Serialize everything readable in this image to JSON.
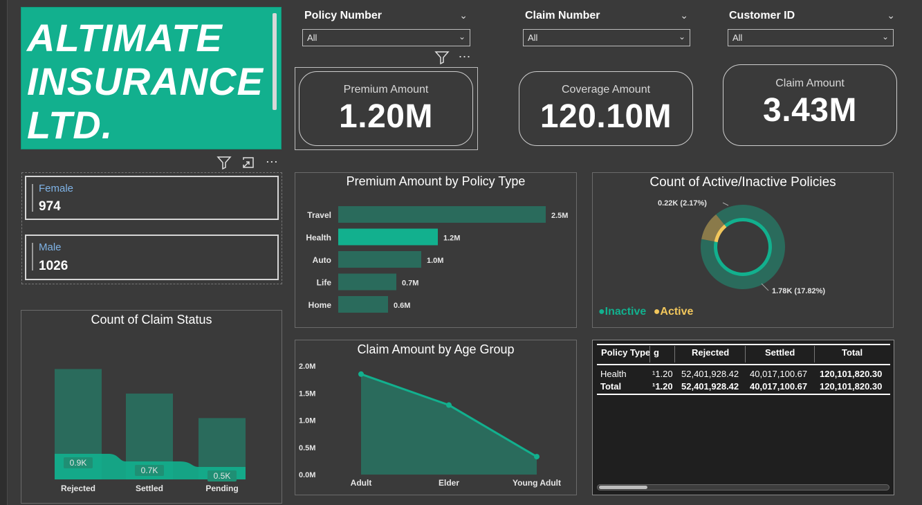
{
  "brand": {
    "lines": [
      "ALTIMATE",
      "INSURANCE",
      "LTD."
    ],
    "color": "#12b08e"
  },
  "slicers": [
    {
      "title": "Policy Number",
      "value": "All"
    },
    {
      "title": "Claim Number",
      "value": "All"
    },
    {
      "title": "Customer ID",
      "value": "All"
    }
  ],
  "kpis": [
    {
      "label": "Premium Amount",
      "value": "1.20M"
    },
    {
      "label": "Coverage Amount",
      "value": "120.10M"
    },
    {
      "label": "Claim Amount",
      "value": "3.43M"
    }
  ],
  "icons": {
    "filter": "filter-icon",
    "more": "more-options-icon",
    "focus": "focus-mode-icon",
    "chevron": "chevron-down-icon"
  },
  "gender_cards": [
    {
      "label": "Female",
      "value": "974"
    },
    {
      "label": "Male",
      "value": "1026"
    }
  ],
  "premium_chart": {
    "title": "Premium Amount by Policy Type",
    "type": "bar",
    "categories": [
      "Travel",
      "Health",
      "Auto",
      "Life",
      "Home"
    ],
    "values": [
      2.5,
      1.2,
      1.0,
      0.7,
      0.6
    ],
    "labels": [
      "2.5M",
      "1.2M",
      "1.0M",
      "0.7M",
      "0.6M"
    ],
    "highlight": "Health",
    "colors": {
      "bar": "#2a6b5c",
      "highlight": "#12b08e"
    }
  },
  "donut_chart": {
    "title": "Count of Active/Inactive Policies",
    "type": "pie",
    "slices": [
      {
        "name": "Inactive",
        "value": 1.78,
        "label": "1.78K (17.82%)",
        "color": "#12b08e"
      },
      {
        "name": "Active",
        "value": 0.22,
        "label": "0.22K (2.17%)",
        "color": "#f2c75c"
      }
    ],
    "legend": [
      "Inactive",
      "Active"
    ]
  },
  "claim_status_chart": {
    "title": "Count of Claim Status",
    "type": "bar",
    "categories": [
      "Rejected",
      "Settled",
      "Pending"
    ],
    "values": [
      0.9,
      0.7,
      0.5
    ],
    "labels": [
      "0.9K",
      "0.7K",
      "0.5K"
    ],
    "ylim": [
      0,
      1.1
    ]
  },
  "age_chart": {
    "title": "Claim Amount by Age Group",
    "type": "area",
    "categories": [
      "Adult",
      "Elder",
      "Young Adult"
    ],
    "values": [
      1.85,
      1.28,
      0.33
    ],
    "yticks": [
      "0.0M",
      "0.5M",
      "1.0M",
      "1.5M",
      "2.0M"
    ],
    "ylim": [
      0,
      2.0
    ]
  },
  "table": {
    "headers": [
      "Policy Type",
      "g",
      "Rejected",
      "Settled",
      "Total"
    ],
    "rows": [
      [
        "Health",
        "¹1.20",
        "52,401,928.42",
        "40,017,100.67",
        "120,101,820.30"
      ],
      [
        "Total",
        "¹1.20",
        "52,401,928.42",
        "40,017,100.67",
        "120,101,820.30"
      ]
    ]
  }
}
